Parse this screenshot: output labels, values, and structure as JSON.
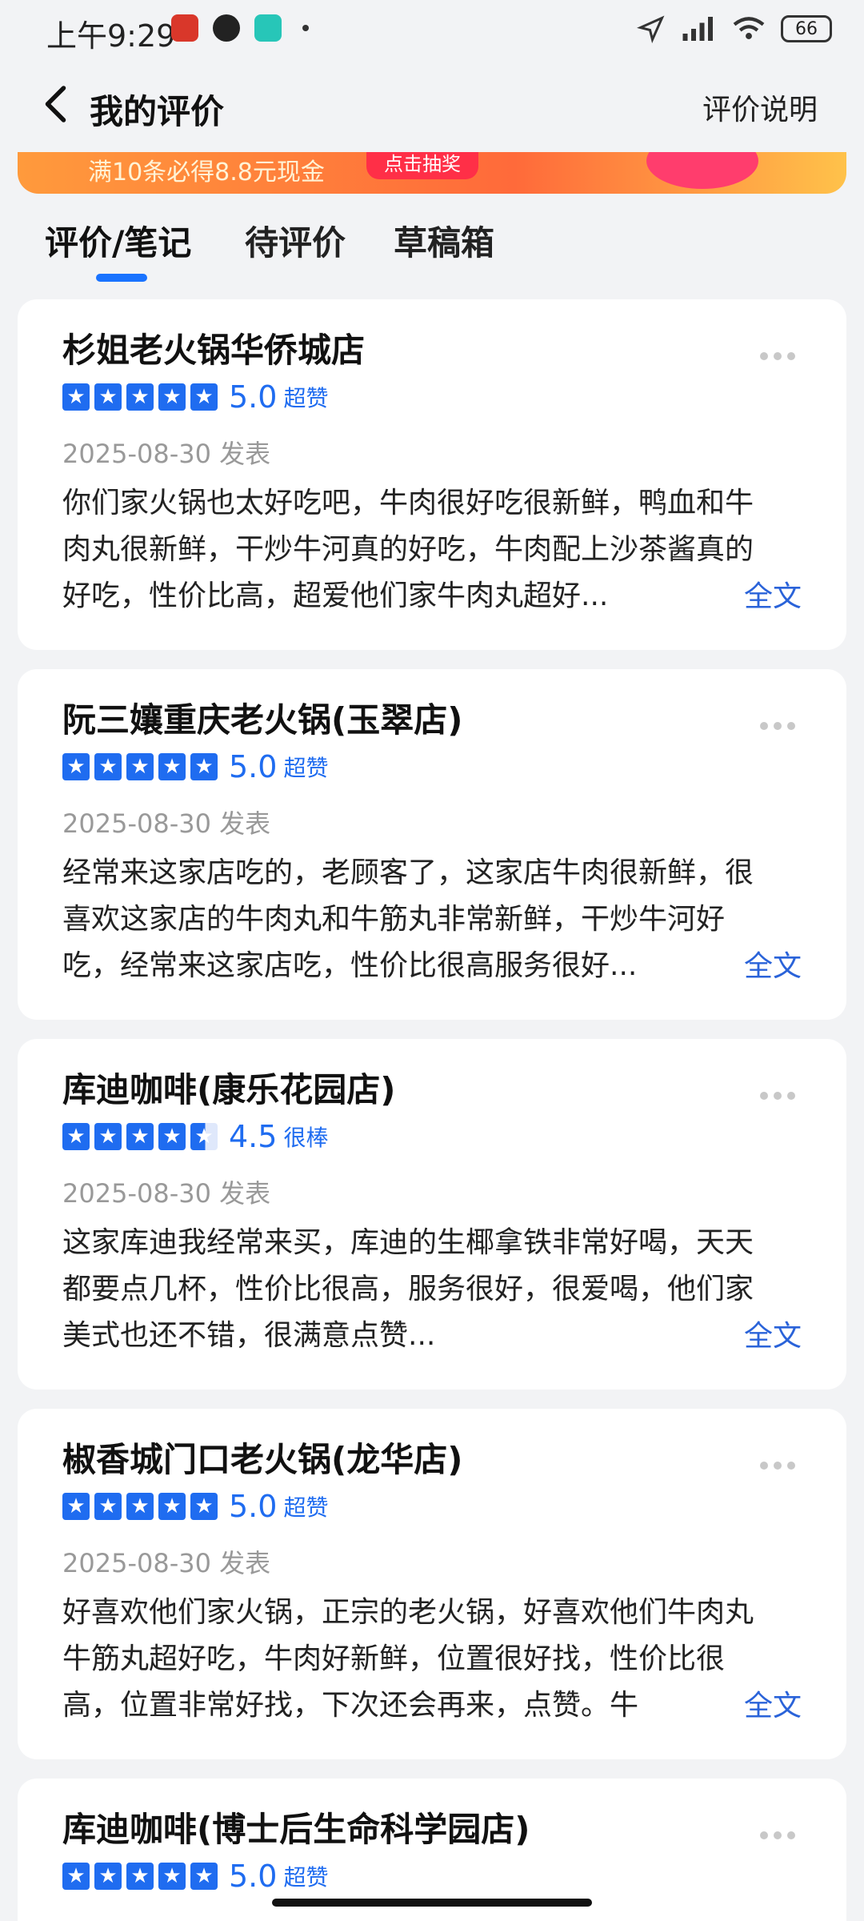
{
  "status_bar": {
    "time": "上午9:29",
    "battery": "66"
  },
  "nav": {
    "title": "我的评价",
    "right_link": "评价说明"
  },
  "banner": {
    "text": "满10条必得8.8元现金",
    "button": "点击抽奖"
  },
  "tabs": [
    "评价/笔记",
    "待评价",
    "草稿箱"
  ],
  "reviews": [
    {
      "shop": "杉姐老火锅华侨城店",
      "score": "5.0",
      "label": "超赞",
      "date": "2025-08-30 发表",
      "content": "你们家火锅也太好吃吧，牛肉很好吃很新鲜，鸭血和牛肉丸很新鲜，干炒牛河真的好吃，牛肉配上沙茶酱真的好吃，性价比高，超爱他们家牛肉丸超好...",
      "full": "全文"
    },
    {
      "shop": "阮三孃重庆老火锅(玉翠店)",
      "score": "5.0",
      "label": "超赞",
      "date": "2025-08-30 发表",
      "content": "经常来这家店吃的，老顾客了，这家店牛肉很新鲜，很喜欢这家店的牛肉丸和牛筋丸非常新鲜，干炒牛河好吃，经常来这家店吃，性价比很高服务很好...",
      "full": "全文"
    },
    {
      "shop": "库迪咖啡(康乐花园店)",
      "score": "4.5",
      "label": "很棒",
      "date": "2025-08-30 发表",
      "content": "这家库迪我经常来买，库迪的生椰拿铁非常好喝，天天都要点几杯，性价比很高，服务很好，很爱喝，他们家美式也还不错，很满意点赞...",
      "full": "全文"
    },
    {
      "shop": "椒香城门口老火锅(龙华店)",
      "score": "5.0",
      "label": "超赞",
      "date": "2025-08-30 发表",
      "content": "好喜欢他们家火锅，正宗的老火锅，好喜欢他们牛肉丸牛筋丸超好吃，牛肉好新鲜，位置很好找，性价比很高，位置非常好找，下次还会再来，点赞。牛",
      "full": "全文"
    },
    {
      "shop": "库迪咖啡(博士后生命科学园店)",
      "score": "5.0",
      "label": "超赞",
      "date": "",
      "content": "",
      "full": ""
    }
  ],
  "icons": {
    "back": "chevron-left-icon",
    "more": "more-dots-icon",
    "star": "star-icon"
  },
  "colors": {
    "accent": "#1f6cf0",
    "link": "#2a63d9",
    "page_bg": "#f2f3f5"
  }
}
